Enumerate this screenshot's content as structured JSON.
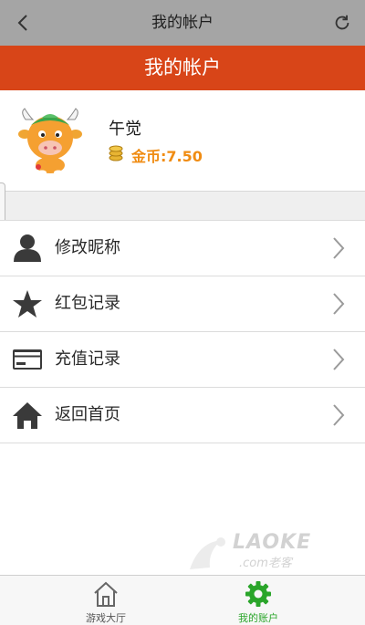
{
  "header": {
    "title": "我的帐户",
    "back_icon": "back-chevron-icon",
    "refresh_icon": "refresh-icon"
  },
  "banner": {
    "title": "我的帐户",
    "color": "#d84518"
  },
  "profile": {
    "username": "午觉",
    "coins_text": "金币:7.50",
    "coin_color": "#f08c12"
  },
  "menu": [
    {
      "label": "修改昵称",
      "icon": "user-icon"
    },
    {
      "label": "红包记录",
      "icon": "star-icon"
    },
    {
      "label": "充值记录",
      "icon": "credit-card-icon"
    },
    {
      "label": "返回首页",
      "icon": "home-icon"
    }
  ],
  "watermark": {
    "text": "LAOKE",
    "sub": ".com老客"
  },
  "tabs": [
    {
      "label": "游戏大厅",
      "icon": "home-outline-icon",
      "active": false
    },
    {
      "label": "我的账户",
      "icon": "gear-icon",
      "active": true,
      "color": "#2aa52a"
    }
  ]
}
